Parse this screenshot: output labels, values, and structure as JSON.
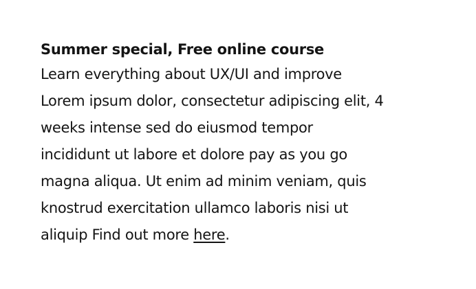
{
  "promo": {
    "headline": "Summer special, Free online course",
    "lines": [
      "Learn everything about UX/UI and improve",
      "Lorem ipsum dolor, consectetur adipiscing elit, 4",
      "weeks intense sed do eiusmod tempor",
      "incididunt ut labore et dolore pay as you go",
      "magna aliqua. Ut enim ad minim veniam, quis",
      "knostrud exercitation ullamco laboris nisi ut"
    ],
    "last_line_prefix": "aliquip Find out more ",
    "link_text": "here",
    "last_line_suffix": "."
  }
}
